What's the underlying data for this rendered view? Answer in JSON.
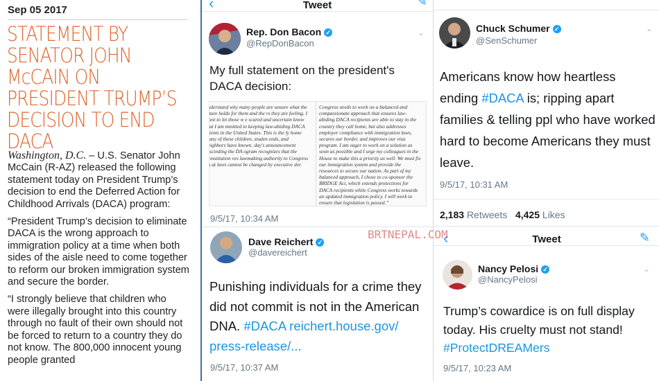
{
  "article": {
    "date": "Sep 05 2017",
    "headline": "STATEMENT BY SENATOR JOHN McCAIN ON PRESIDENT TRUMP’S DECISION TO END DACA",
    "dateline": "Washington, D.C.",
    "p1": " – U.S. Senator John McCain (R-AZ) released the following statement today on President Trump’s decision to end the Deferred Action for Childhood Arrivals (DACA) program:",
    "p2": "“President Trump’s decision to eliminate DACA is the wrong approach to immigration policy at a time when both sides of the aisle need to come together to reform our broken immigration system and secure the border.",
    "p3": "“I strongly believe that children who were illegally brought into this country through no fault of their own should not be forced to return to a country they do not know. The 800,000 innocent young people granted"
  },
  "header_title": "Tweet",
  "tweets": {
    "bacon": {
      "name": "Rep. Don Bacon",
      "handle": "@RepDonBacon",
      "text": "My full statement on the president's DACA decision:",
      "doc_col1": "understand why many people are unsure what the future holds for them and the rs they are feeling. I want to let those w e scared and uncertain know that I am mmitted to keeping law-abiding DACA ipients in the United States. This is the ly home many of these children, studen ends, and neighbors have known. day's announcement rescinding the DA ogram recognizes that the Constitution ves lawmaking authority to Congress an at laws cannot be changed by executive der.",
      "doc_col2": "Congress needs to work on a balanced and compassionate approach that ensures law-abiding DACA recipients are able to stay in the country they call home, but also addresses employer compliance with immigration laws, secures our border, and improves our visa program. I am eager to work on a solution as soon as possible and I urge my colleagues in the House to make this a priority as well. We must fix our immigration system and provide the resources to secure our nation. As part of my balanced approach, I chose to co-sponsor the BRIDGE Act, which extends protections for DACA recipients while Congress works towards an updated immigration policy. I will work to ensure that legislation is passed.”",
      "time": "9/5/17, 10:34 AM"
    },
    "reichert": {
      "name": "Dave Reichert",
      "handle": "@davereichert",
      "text_pre": "Punishing individuals for a crime they did not commit is not in the American DNA. ",
      "hashtag": "#DACA",
      "link": " reichert.house.gov/ press-release/...",
      "time": "9/5/17, 10:37 AM"
    },
    "schumer": {
      "name": "Chuck Schumer",
      "handle": "@SenSchumer",
      "text_pre": "Americans know how heartless ending ",
      "hashtag": "#DACA",
      "text_post": " is; ripping apart families & telling ppl who have worked hard to become Americans they must leave.",
      "time": "9/5/17, 10:31 AM",
      "retweets": "2,183",
      "retweets_label": "Retweets",
      "likes": "4,425",
      "likes_label": "Likes"
    },
    "pelosi": {
      "name": "Nancy Pelosi",
      "handle": "@NancyPelosi",
      "text": "Trump’s cowardice is on full display today. His cruelty must not stand! ",
      "hashtag": "#ProtectDREAMers",
      "time": "9/5/17, 10:23 AM"
    }
  },
  "watermark": "BRTNEPAL.COM",
  "colors": {
    "accent": "#1da1f2",
    "headline": "#e0632a",
    "divider": "#3b6fb6"
  }
}
